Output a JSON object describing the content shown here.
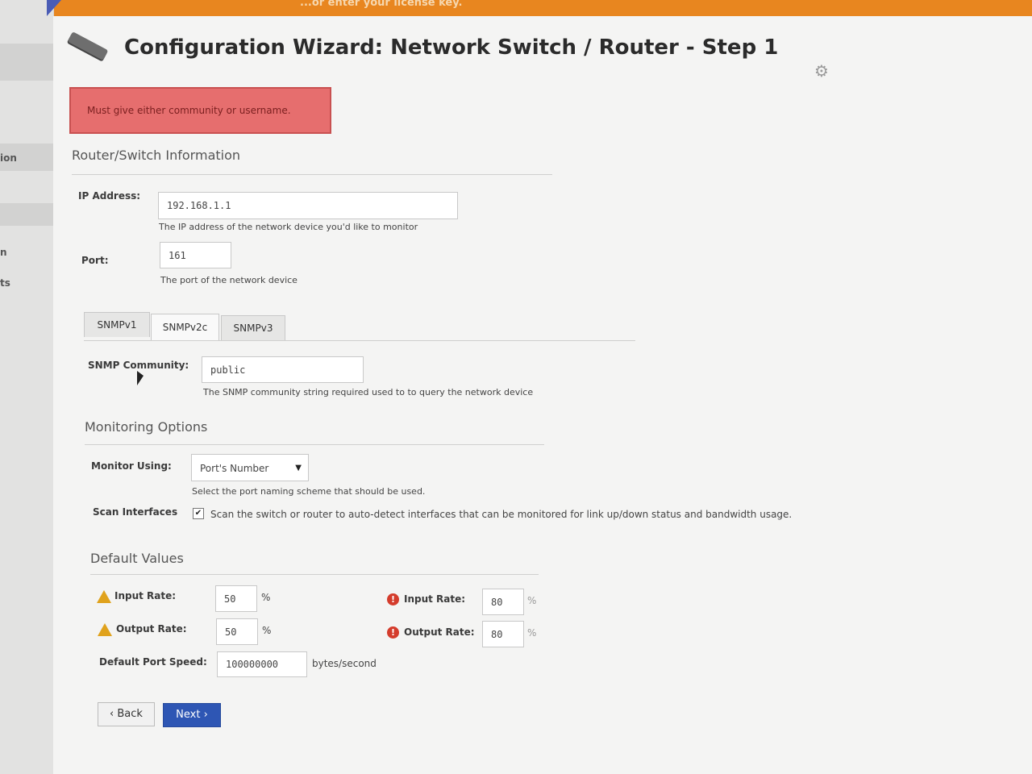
{
  "banner": {
    "notice": "...or enter your license key."
  },
  "sidebar": {
    "items": [
      "ion",
      "n",
      "ts"
    ]
  },
  "header": {
    "title": "Configuration Wizard: Network Switch / Router - Step 1"
  },
  "error": {
    "message": "Must give either community or username."
  },
  "router_info": {
    "heading": "Router/Switch Information",
    "ip_label": "IP Address:",
    "ip_value": "192.168.1.1",
    "ip_help": "The IP address of the network device you'd like to monitor",
    "port_label": "Port:",
    "port_value": "161",
    "port_help": "The port of the network device"
  },
  "tabs": [
    {
      "label": "SNMPv1",
      "active": false
    },
    {
      "label": "SNMPv2c",
      "active": true
    },
    {
      "label": "SNMPv3",
      "active": false
    }
  ],
  "snmp": {
    "community_label": "SNMP Community:",
    "community_value": "public",
    "community_help": "The SNMP community string required used to to query the network device"
  },
  "monitoring": {
    "heading": "Monitoring Options",
    "monitor_label": "Monitor Using:",
    "monitor_value": "Port's Number",
    "monitor_help": "Select the port naming scheme that should be used.",
    "scan_label": "Scan Interfaces",
    "scan_checked": true,
    "scan_text": "Scan the switch or router to auto-detect interfaces that can be monitored for link up/down status and bandwidth usage."
  },
  "defaults": {
    "heading": "Default Values",
    "warn_input_label": "Input Rate:",
    "warn_input_value": "50",
    "warn_output_label": "Output Rate:",
    "warn_output_value": "50",
    "crit_input_label": "Input Rate:",
    "crit_input_value": "80",
    "crit_output_label": "Output Rate:",
    "crit_output_value": "80",
    "percent": "%",
    "speed_label": "Default Port Speed:",
    "speed_value": "100000000",
    "speed_unit": "bytes/second"
  },
  "buttons": {
    "back": "Back",
    "next": "Next"
  },
  "colors": {
    "topbar": "#e8861f",
    "error_bg": "#e66e6e",
    "next_button": "#2e56b4"
  }
}
